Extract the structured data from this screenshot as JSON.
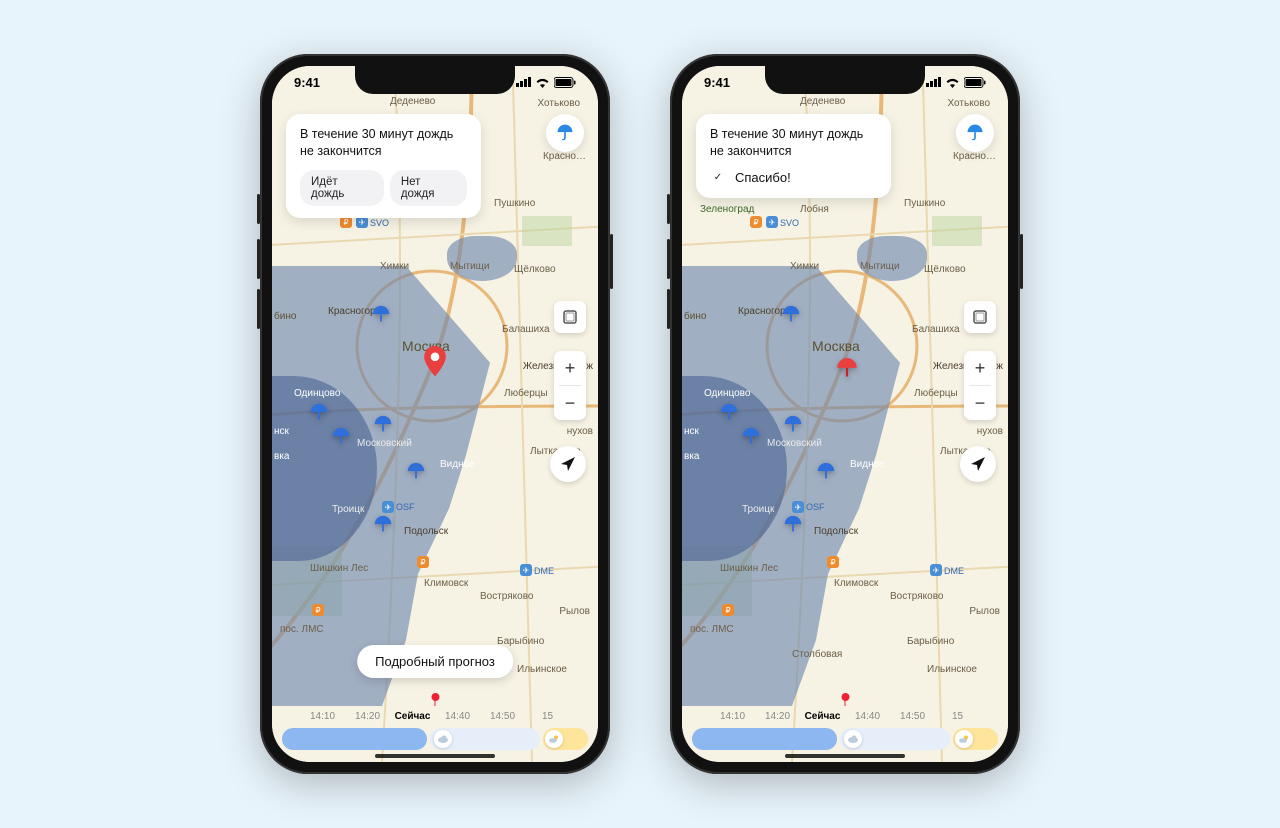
{
  "status": {
    "time": "9:41"
  },
  "card": {
    "message": "В течение 30 минут дождь не закончится",
    "btn_rain": "Идёт дождь",
    "btn_no_rain": "Нет дождя",
    "thanks": "Спасибо!"
  },
  "detail_button": "Подробный прогноз",
  "timeline": {
    "items": [
      "14:10",
      "14:20",
      "Сейчас",
      "14:40",
      "14:50",
      "15"
    ],
    "now_index": 2
  },
  "cities": {
    "moscow": "Москва",
    "zelenograd": "Зеленоград",
    "dedenevo": "Деденево",
    "khotkov": "Хотьково",
    "lobnya": "Лобня",
    "pushkino": "Пушкино",
    "mytishchi": "Мытищи",
    "shchelkovo": "Щёлково",
    "khimki": "Химки",
    "krasnogorsk": "Красногорск",
    "balashikha": "Балашиха",
    "zheleznodor": "Железнодорож",
    "lyubertsy": "Люберцы",
    "nukhov": "нухов",
    "lytkarino": "Лыткарино",
    "vidnoe": "Видное",
    "moskovskiy": "Московский",
    "troitsk": "Троицк",
    "podolsk": "Подольск",
    "klimovsk": "Климовск",
    "odintsovo": "Одинцово",
    "vostryakovo": "Востряково",
    "rylov": "Рылов",
    "barybino": "Барыбино",
    "stolbovaya": "Столбовая",
    "ilinskoe": "Ильинское",
    "shishkin": "Шишкин Лес",
    "lms": "пос. ЛМС",
    "krasnoe": "Красно…",
    "nsk": "нск",
    "bino": "бино",
    "vka": "вка"
  },
  "poi": {
    "svo": "SVO",
    "dme": "DME",
    "osf": "OSF"
  },
  "colors": {
    "rain_overlay": "rgba(108,134,175,0.62)",
    "rain_dark": "rgba(80,105,150,0.65)",
    "umbrella_blue": "#2f6fdc",
    "pin_red": "#ea3f3f",
    "accent_blue": "#2a89e6"
  }
}
